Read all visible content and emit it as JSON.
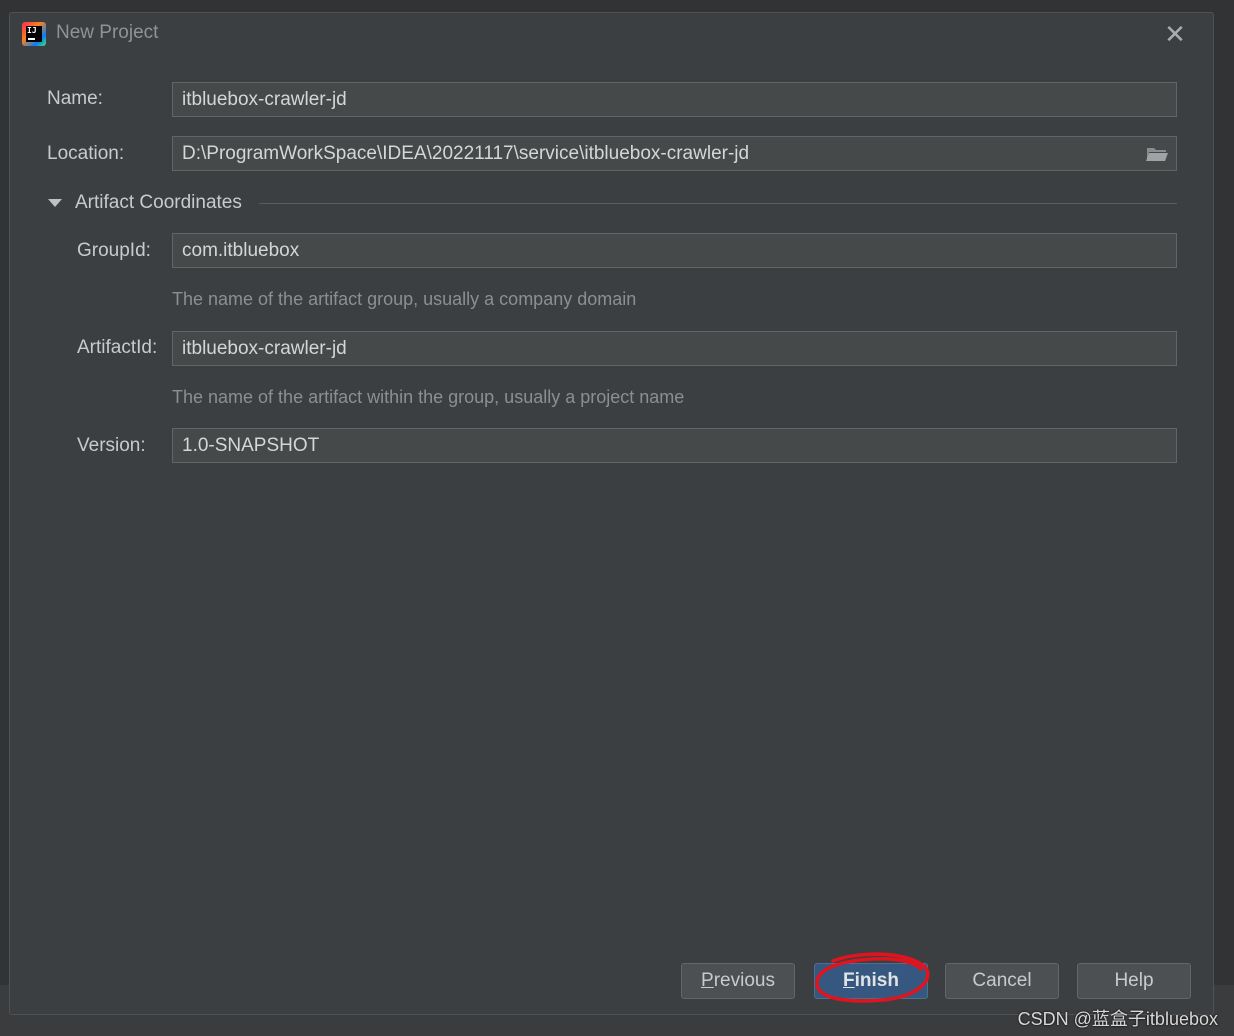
{
  "window": {
    "title": "New Project",
    "close_glyph": "✕"
  },
  "form": {
    "name": {
      "label": "Name:",
      "value": "itbluebox-crawler-jd"
    },
    "location": {
      "label": "Location:",
      "value": "D:\\ProgramWorkSpace\\IDEA\\20221117\\service\\itbluebox-crawler-jd"
    },
    "artifact_section": {
      "title": "Artifact Coordinates"
    },
    "group_id": {
      "label": "GroupId:",
      "value": "com.itbluebox",
      "hint": "The name of the artifact group, usually a company domain"
    },
    "artifact_id": {
      "label": "ArtifactId:",
      "value": "itbluebox-crawler-jd",
      "hint": "The name of the artifact within the group, usually a project name"
    },
    "version": {
      "label": "Version:",
      "value": "1.0-SNAPSHOT"
    }
  },
  "buttons": {
    "previous": {
      "mnemonic": "P",
      "rest": "revious"
    },
    "finish": {
      "mnemonic": "F",
      "rest": "inish"
    },
    "cancel": "Cancel",
    "help": "Help"
  },
  "watermark": "CSDN @蓝盒子itbluebox",
  "colors": {
    "dialog_bg": "#3c3f41",
    "field_bg": "#45494a",
    "default_button": "#365880",
    "annotation": "#e0141e"
  }
}
